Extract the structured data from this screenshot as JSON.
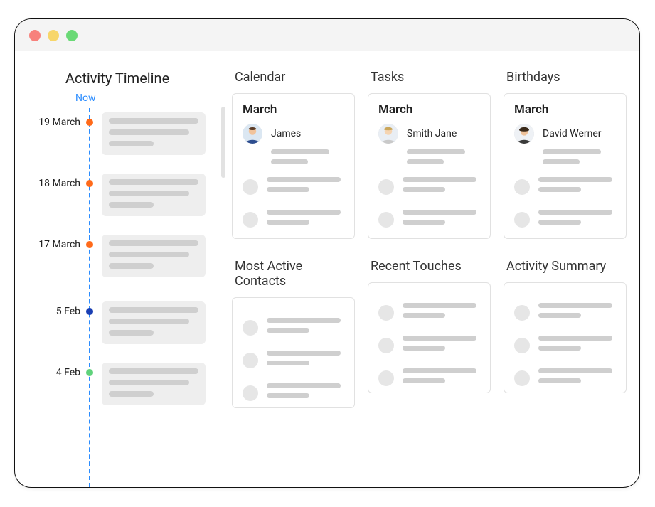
{
  "timeline": {
    "title": "Activity Timeline",
    "now_label": "Now",
    "items": [
      {
        "date": "19 March",
        "dot": "orange"
      },
      {
        "date": "18 March",
        "dot": "orange"
      },
      {
        "date": "17 March",
        "dot": "orange"
      },
      {
        "date": "5 Feb",
        "dot": "blue"
      },
      {
        "date": "4 Feb",
        "dot": "green"
      }
    ]
  },
  "dashboard": {
    "row1": [
      {
        "title": "Calendar",
        "month": "March",
        "person": "James"
      },
      {
        "title": "Tasks",
        "month": "March",
        "person": "Smith Jane"
      },
      {
        "title": "Birthdays",
        "month": "March",
        "person": "David Werner"
      }
    ],
    "row2": [
      {
        "title": "Most Active Contacts"
      },
      {
        "title": "Recent Touches"
      },
      {
        "title": "Activity Summary"
      }
    ]
  }
}
